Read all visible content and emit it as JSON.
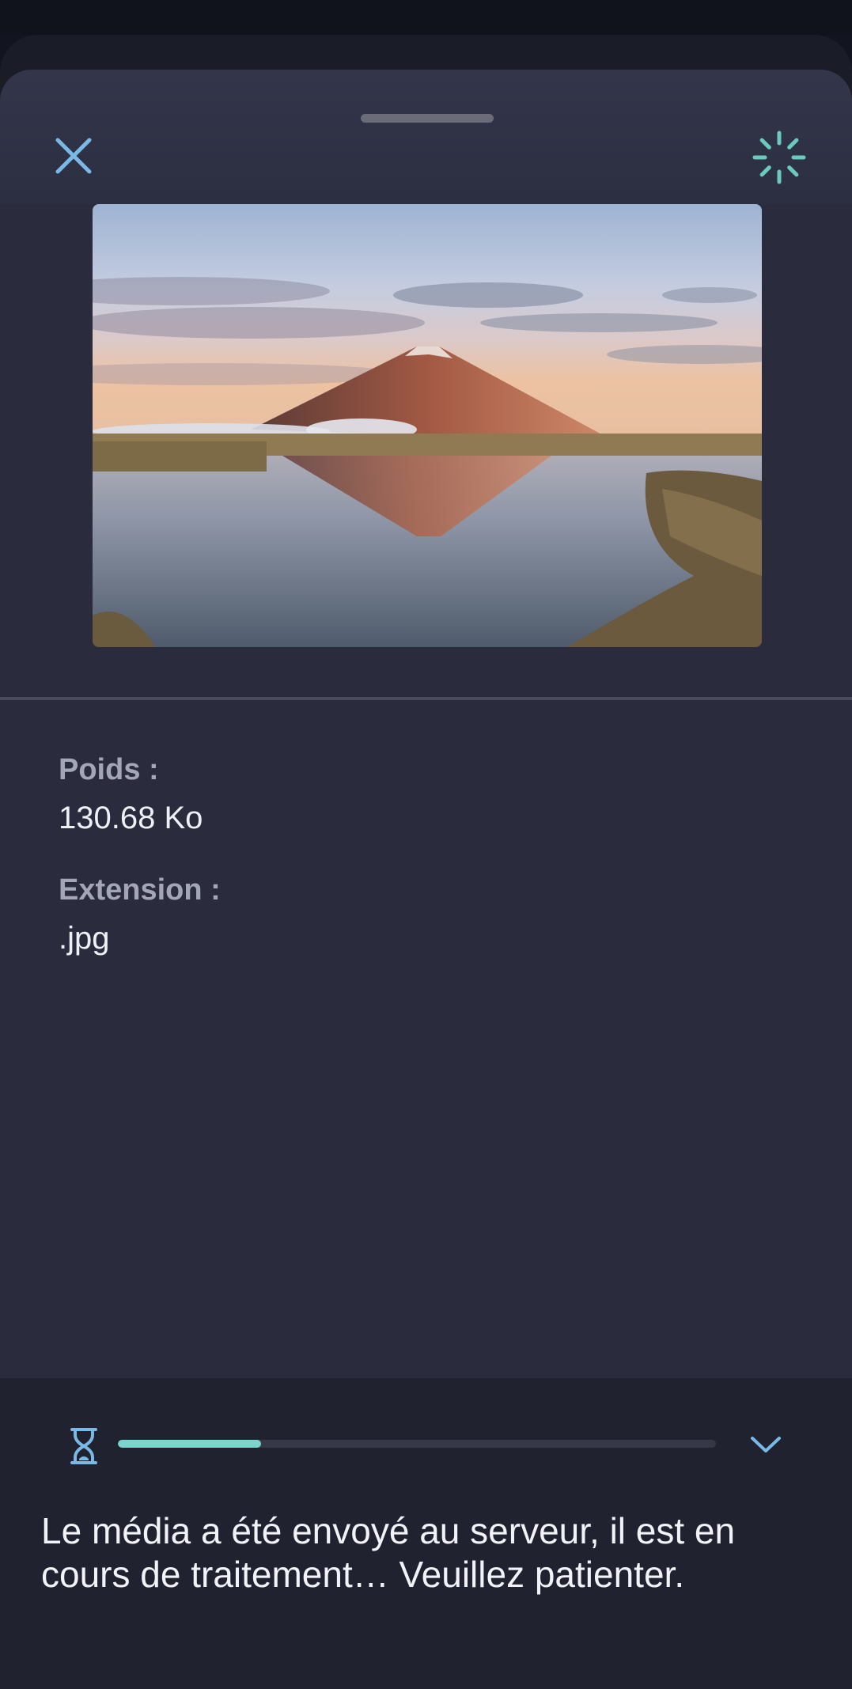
{
  "header": {
    "close_icon": "close-icon",
    "loading_icon": "spinner-icon",
    "accent_color": "#7ab8e6",
    "spinner_color": "#6cc9be"
  },
  "media": {
    "preview_alt": "Aperçu du média"
  },
  "details": {
    "weight_label": "Poids :",
    "weight_value": "130.68 Ko",
    "extension_label": "Extension :",
    "extension_value": ".jpg"
  },
  "upload_status": {
    "state_icon": "hourglass-icon",
    "progress": 0.24,
    "progress_color": "#7fd3cd",
    "collapse_icon": "chevron-down-icon",
    "message": "Le média a été envoyé au serveur, il est en cours de traitement… Veuillez patienter."
  }
}
